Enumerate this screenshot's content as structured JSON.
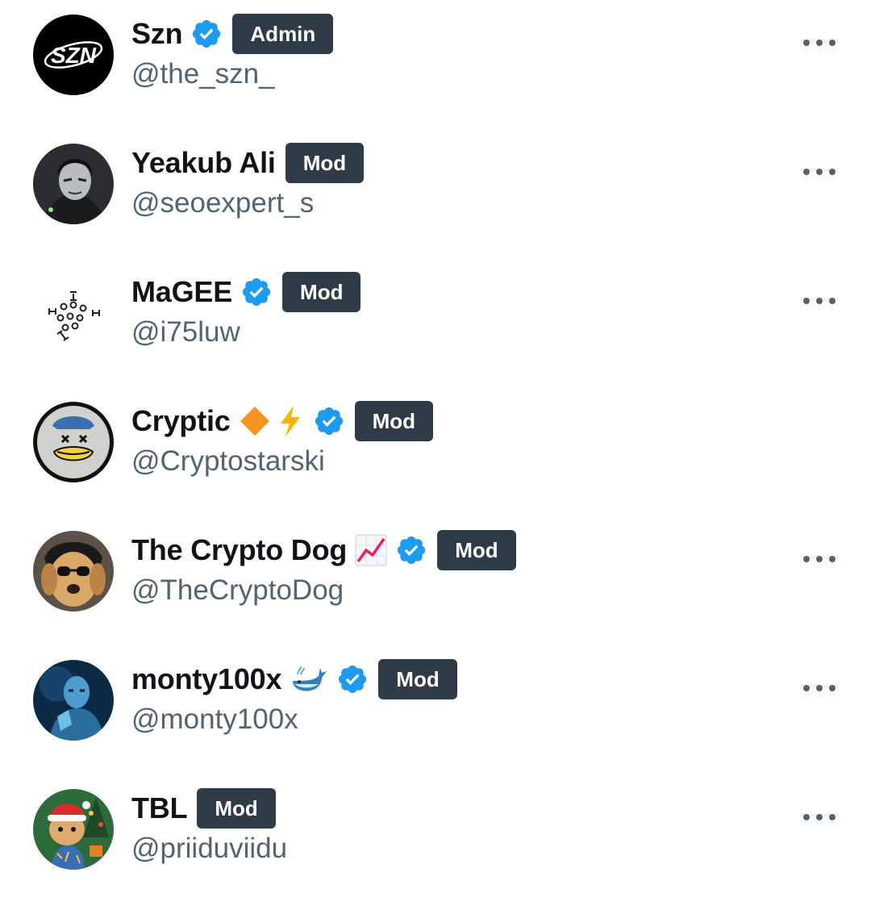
{
  "members": [
    {
      "name": "Szn",
      "handle": "@the_szn_",
      "role": "Admin",
      "verified": true,
      "emojis": [],
      "avatar": "szn-logo-avatar",
      "more_icon": "more-horizontal-icon"
    },
    {
      "name": "Yeakub Ali",
      "handle": "@seoexpert_s",
      "role": "Mod",
      "verified": false,
      "emojis": [],
      "avatar": "dark-portrait-avatar",
      "more_icon": "more-horizontal-icon"
    },
    {
      "name": "MaGEE",
      "handle": "@i75luw",
      "role": "Mod",
      "verified": true,
      "emojis": [],
      "avatar": "molecule-pattern-avatar",
      "more_icon": "more-horizontal-icon"
    },
    {
      "name": "Cryptic",
      "handle": "@Cryptostarski",
      "role": "Mod",
      "verified": true,
      "emojis": [
        "orange-diamond-emoji",
        "lightning-emoji"
      ],
      "avatar": "duck-cartoon-avatar",
      "more_icon": "more-horizontal-icon"
    },
    {
      "name": "The Crypto Dog",
      "handle": "@TheCryptoDog",
      "role": "Mod",
      "verified": true,
      "emojis": [
        "chart-increasing-emoji"
      ],
      "avatar": "dog-sunglasses-avatar",
      "more_icon": "more-horizontal-icon"
    },
    {
      "name": "monty100x",
      "handle": "@monty100x",
      "role": "Mod",
      "verified": true,
      "emojis": [
        "whale-emoji"
      ],
      "avatar": "robot-blue-avatar",
      "more_icon": "more-horizontal-icon"
    },
    {
      "name": "TBL",
      "handle": "@priiduviidu",
      "role": "Mod",
      "verified": false,
      "emojis": [],
      "avatar": "santa-dog-avatar",
      "more_icon": "more-horizontal-icon"
    }
  ],
  "colors": {
    "text_primary": "#0f1419",
    "text_secondary": "#536471",
    "badge_bg": "#2f3c47",
    "badge_text": "#ffffff",
    "verified_blue": "#1d9bf0"
  }
}
